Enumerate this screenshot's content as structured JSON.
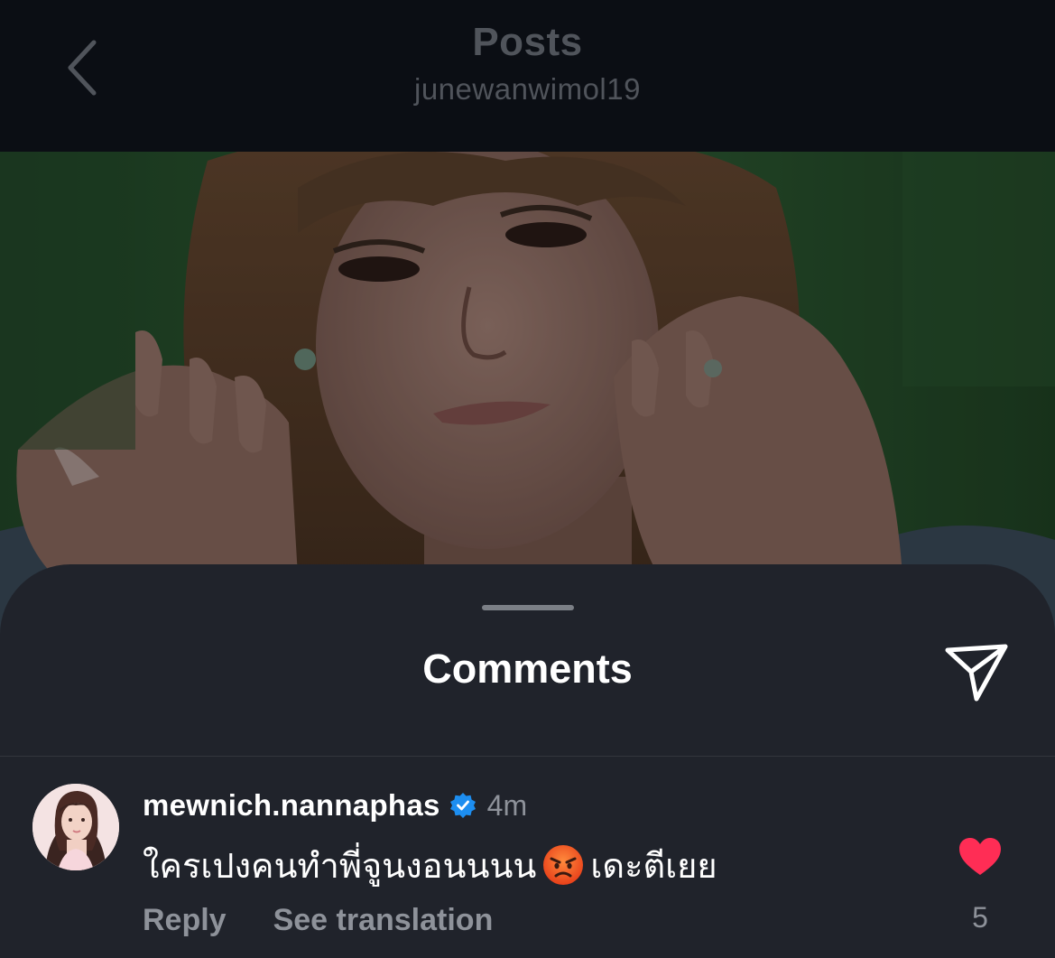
{
  "header": {
    "title": "Posts",
    "subtitle": "junewanwimol19",
    "back_icon": "chevron-left-icon"
  },
  "sheet": {
    "title": "Comments",
    "share_icon": "send-icon"
  },
  "comments": [
    {
      "username": "mewnich.nannaphas",
      "verified": true,
      "time": "4m",
      "text_before": "ใครเปงคนทำพี่จูนงอนนนน",
      "emoji": "angry-face-emoji",
      "text_after": "เดะตีเยย",
      "reply_label": "Reply",
      "translate_label": "See translation",
      "liked": true,
      "like_count": "5"
    }
  ],
  "colors": {
    "background": "#0b0e14",
    "sheet": "#20232b",
    "muted_text": "#8e929a",
    "header_text": "#50545b",
    "like": "#ff2d55",
    "verified": "#1d8ef0"
  }
}
